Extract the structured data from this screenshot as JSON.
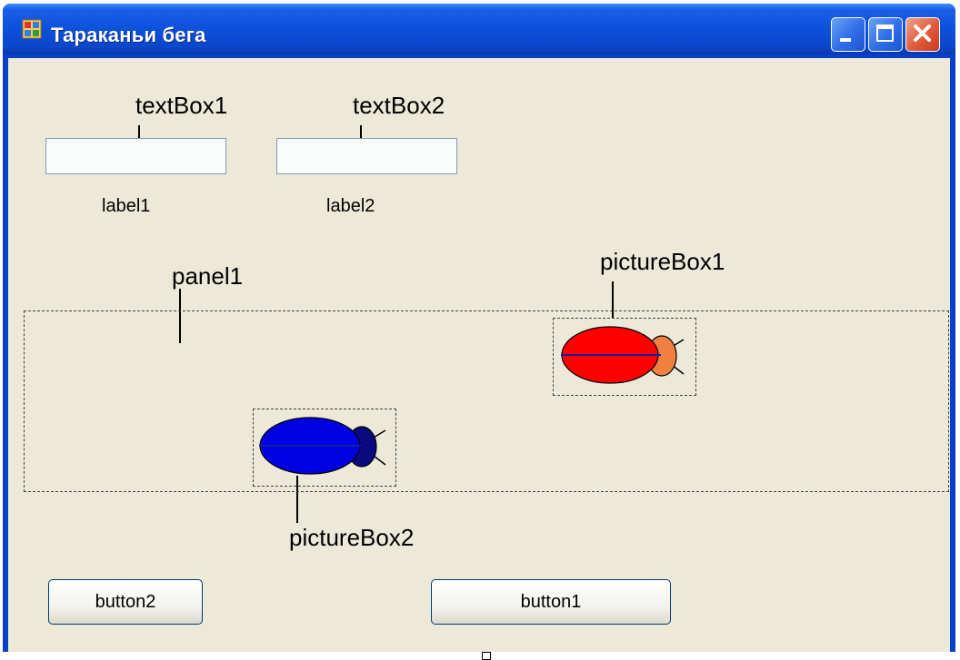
{
  "window": {
    "title": "Тараканьи бега",
    "icon": "form-icon",
    "caption_buttons": [
      "minimize",
      "maximize",
      "close"
    ],
    "colors": {
      "titlebar": "#0b4fd9",
      "client": "#ece9d8",
      "close": "#e05a3c"
    }
  },
  "annotations": {
    "textbox1": "textBox1",
    "textbox2": "textBox2",
    "panel1": "panel1",
    "picturebox1": "pictureBox1",
    "picturebox2": "pictureBox2"
  },
  "textboxes": [
    {
      "value": "",
      "placeholder": ""
    },
    {
      "value": "",
      "placeholder": ""
    }
  ],
  "labels": {
    "label1": "label1",
    "label2": "label2"
  },
  "buttons": {
    "button1": "button1",
    "button2": "button2"
  },
  "bugs": {
    "picturebox1": {
      "body_color": "#ff0000",
      "head_color": "#f08040"
    },
    "picturebox2": {
      "body_color": "#0000e0",
      "head_color": "#0a0a80"
    }
  }
}
